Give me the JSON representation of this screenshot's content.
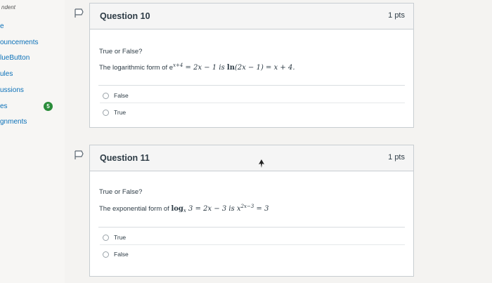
{
  "sidebar": {
    "top_label": "ndent",
    "items": [
      {
        "label": "e"
      },
      {
        "label": "ouncements"
      },
      {
        "label": "lueButton"
      },
      {
        "label": "ules"
      },
      {
        "label": "ussions"
      },
      {
        "label": "es"
      },
      {
        "label": "gnments"
      }
    ],
    "badge": "5"
  },
  "questions": [
    {
      "title": "Question 10",
      "points": "1 pts",
      "prompt": "True or False?",
      "statement_pre": "The logarithmic form of e",
      "statement_exp": "x+4",
      "statement_mid": " = 2x − 1 is ",
      "statement_ln": "ln",
      "statement_post": "(2x − 1) = x + 4.",
      "answers": [
        {
          "label": "False"
        },
        {
          "label": "True"
        }
      ]
    },
    {
      "title": "Question 11",
      "points": "1 pts",
      "prompt": "True or False?",
      "statement_pre": "The exponential form of ",
      "statement_log": "log",
      "statement_sub": "x",
      "statement_mid": " 3 = 2x − 3 is x",
      "statement_exp": "2x−3",
      "statement_post": " = 3",
      "answers": [
        {
          "label": "True"
        },
        {
          "label": "False"
        }
      ]
    }
  ]
}
